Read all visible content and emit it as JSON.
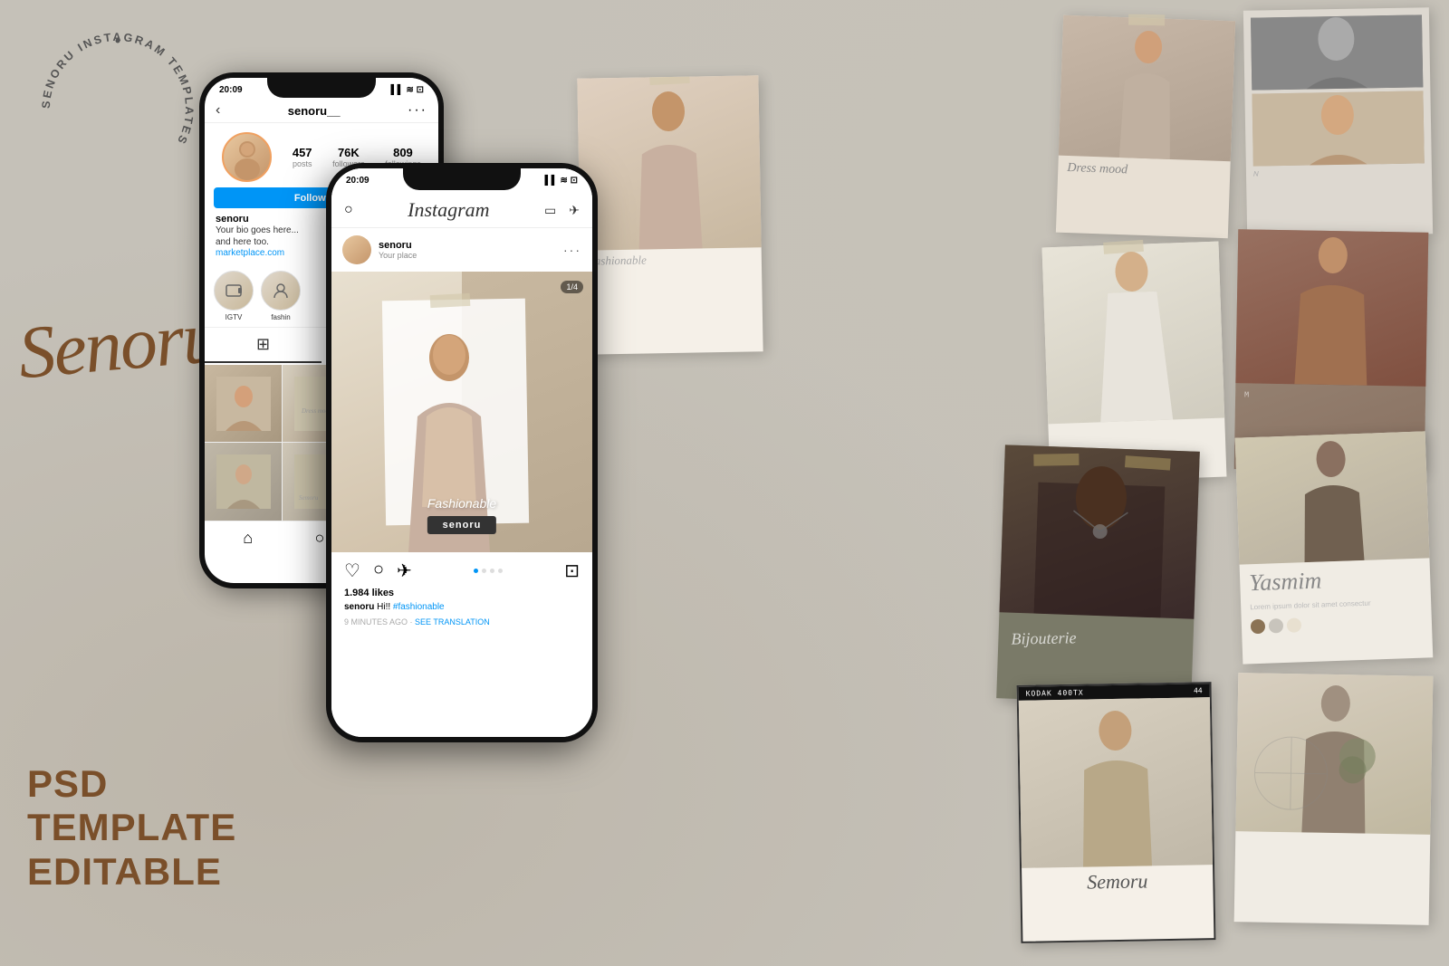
{
  "brand": {
    "name": "Senoru",
    "subtitle": "Senoru Instagram Templates",
    "circular_text": "SENORU INSTAGRAM TEMPLATES",
    "psd_line1": "PSD",
    "psd_line2": "TEMPLATE",
    "psd_line3": "EDITABLE",
    "script_name": "Senoru"
  },
  "phone_back": {
    "time": "20:09",
    "username": "senoru__",
    "stats": {
      "posts": "457",
      "posts_label": "posts",
      "followers": "76K",
      "followers_label": "followers",
      "followings": "809",
      "followings_label": "followings"
    },
    "follow_btn": "Follow",
    "bio_name": "senoru",
    "bio_text": "Your bio goes here...\nand here too.",
    "bio_link": "marketplace.com",
    "highlights": [
      "IGTV",
      "fashin"
    ],
    "grid_labels": [
      "",
      "Dress mood",
      "Fashionable",
      "",
      "Semoru",
      ""
    ]
  },
  "phone_front": {
    "time": "20:09",
    "header_logo": "Instagram",
    "post_username": "senoru",
    "post_location": "Your place",
    "post_counter": "1/4",
    "post_fashionable": "Fashionable",
    "post_badge": "senoru",
    "likes": "1.984 likes",
    "caption_user": "senoru",
    "caption_text": "Hi!! #fashionable",
    "post_time": "9 MINUTES AGO",
    "see_translation": "SEE TRANSLATION",
    "dots": [
      true,
      false,
      false,
      false
    ]
  },
  "cards": {
    "fashionable_label": "Fashionable",
    "dress_mood_label": "Dress mood",
    "bijouterie_label": "Bijouterie",
    "yasmim_label": "Yasmim",
    "senoru_film_label": "Semoru",
    "kodak": "KODAK 400TX",
    "frame_number": "44"
  },
  "colors": {
    "bg": "#c5c1b8",
    "brand_brown": "#7a4f2a",
    "follow_blue": "#0095f6",
    "dark": "#111111",
    "light_card": "#f0ece4"
  }
}
